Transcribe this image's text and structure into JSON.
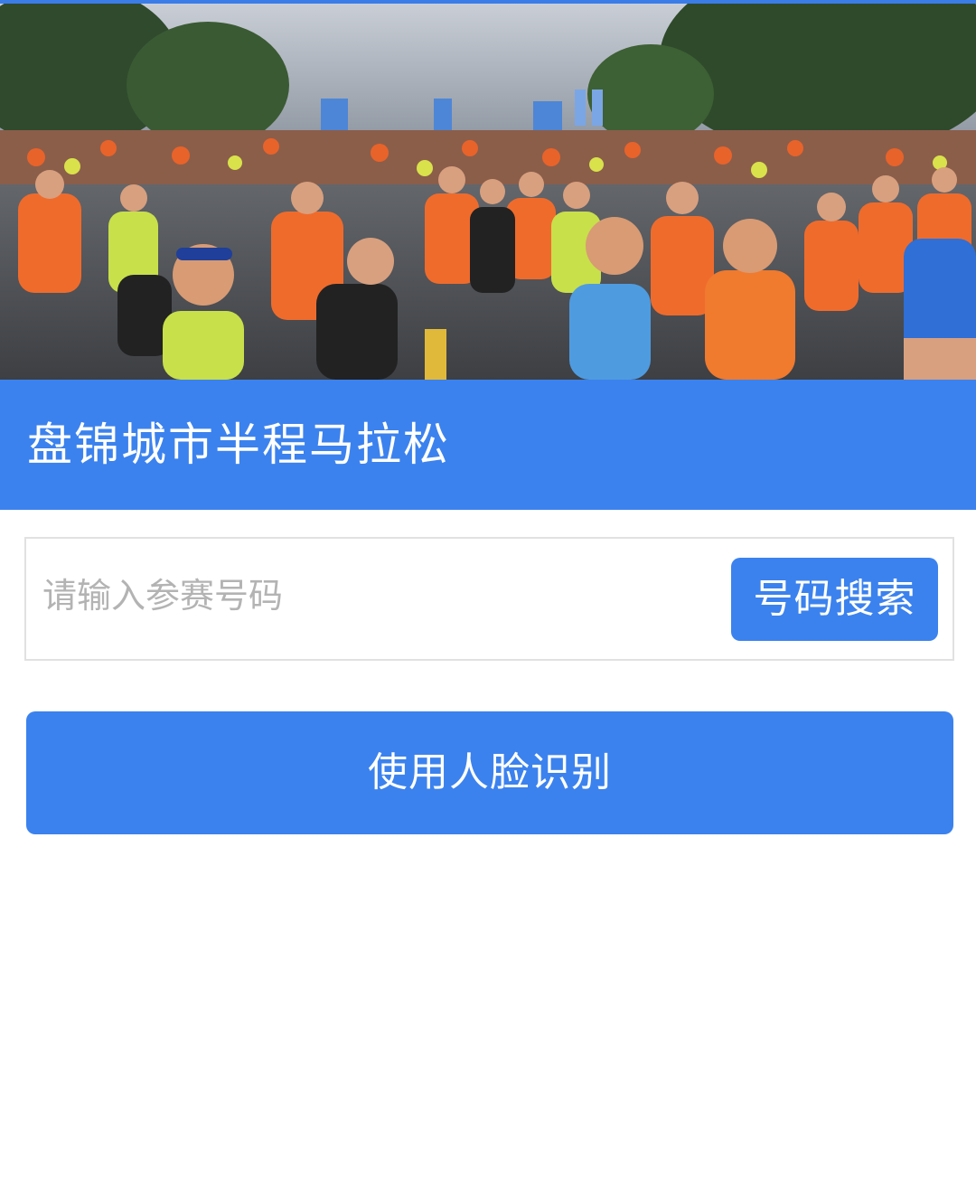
{
  "hero": {
    "image": "marathon-runners-photo"
  },
  "header": {
    "title": "盘锦城市半程马拉松"
  },
  "search": {
    "placeholder": "请输入参赛号码",
    "value": "",
    "button_label": "号码搜索"
  },
  "face_recognition": {
    "button_label": "使用人脸识别"
  },
  "colors": {
    "brand": "#3b82ee",
    "accent": "#f26a2e",
    "input_border": "#e1e1e1",
    "placeholder": "#b3b3b3"
  }
}
